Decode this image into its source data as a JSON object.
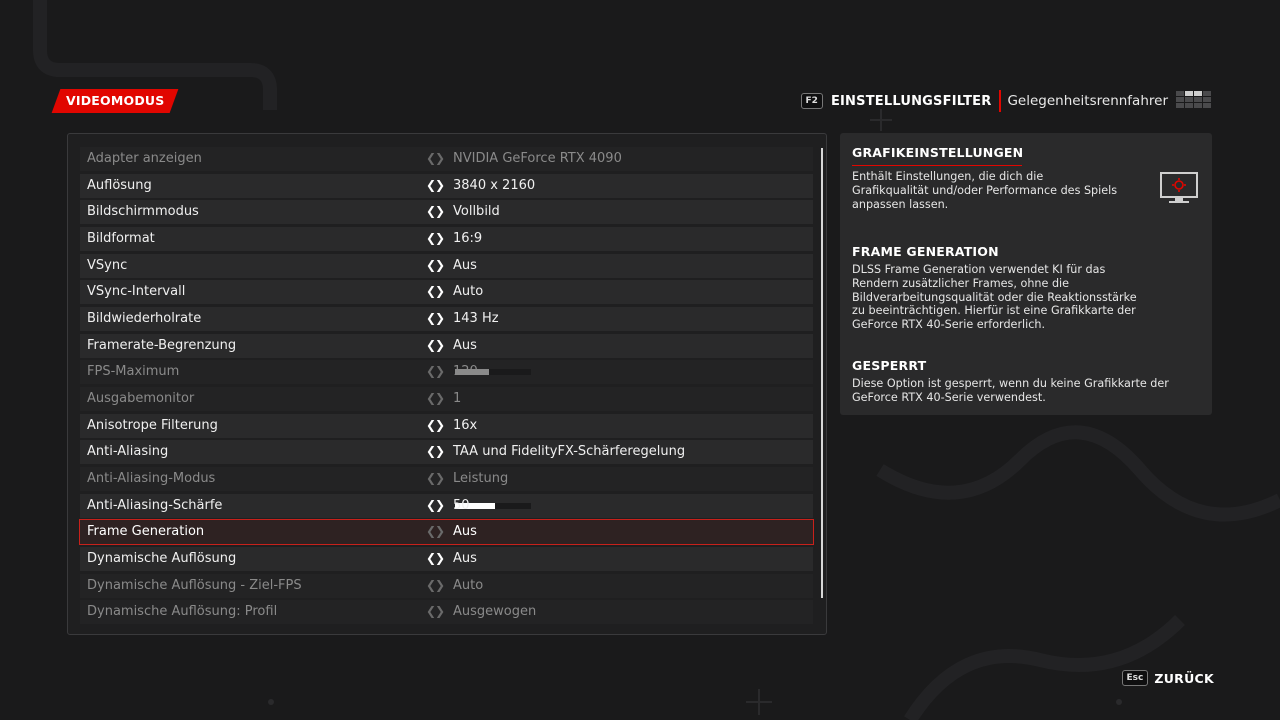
{
  "header": {
    "mode_label": "VIDEOMODUS",
    "filter_key": "F2",
    "filter_label": "EINSTELLUNGSFILTER",
    "filter_value": "Gelegenheitsrennfahrer",
    "filter_icon": "preset-grid-icon"
  },
  "settings": [
    {
      "label": "Adapter anzeigen",
      "value": "NVIDIA GeForce RTX 4090",
      "state": "disabled"
    },
    {
      "label": "Auflösung",
      "value": "3840 x 2160",
      "state": "enabled"
    },
    {
      "label": "Bildschirmmodus",
      "value": "Vollbild",
      "state": "enabled"
    },
    {
      "label": "Bildformat",
      "value": "16:9",
      "state": "enabled"
    },
    {
      "label": "VSync",
      "value": "Aus",
      "state": "enabled"
    },
    {
      "label": "VSync-Intervall",
      "value": "Auto",
      "state": "enabled"
    },
    {
      "label": "Bildwiederholrate",
      "value": "143 Hz",
      "state": "enabled"
    },
    {
      "label": "Framerate-Begrenzung",
      "value": "Aus",
      "state": "enabled"
    },
    {
      "label": "FPS-Maximum",
      "value": "120",
      "state": "disabled",
      "slider_fraction": 0.45
    },
    {
      "label": "Ausgabemonitor",
      "value": "1",
      "state": "disabled"
    },
    {
      "label": "Anisotrope Filterung",
      "value": "16x",
      "state": "enabled"
    },
    {
      "label": "Anti-Aliasing",
      "value": "TAA und FidelityFX-Schärferegelung",
      "state": "enabled"
    },
    {
      "label": "Anti-Aliasing-Modus",
      "value": "Leistung",
      "state": "disabled"
    },
    {
      "label": "Anti-Aliasing-Schärfe",
      "value": "50",
      "state": "enabled",
      "slider_fraction": 0.53
    },
    {
      "label": "Frame Generation",
      "value": "Aus",
      "state": "selected"
    },
    {
      "label": "Dynamische Auflösung",
      "value": "Aus",
      "state": "enabled"
    },
    {
      "label": "Dynamische Auflösung - Ziel-FPS",
      "value": "Auto",
      "state": "disabled"
    },
    {
      "label": "Dynamische Auflösung: Profil",
      "value": "Ausgewogen",
      "state": "disabled"
    }
  ],
  "info": {
    "section1_title": "GRAFIKEINSTELLUNGEN",
    "section1_text": "Enthält Einstellungen, die dich die Grafikqualität und/oder Performance des Spiels anpassen lassen.",
    "section2_title": "FRAME GENERATION",
    "section2_text": "DLSS Frame Generation verwendet KI für das Rendern zusätzlicher Frames, ohne die Bildverarbeitungsqualität oder die Reaktionsstärke zu beeinträchtigen. Hierfür ist eine Grafikkarte der GeForce RTX 40-Serie erforderlich.",
    "section3_title": "GESPERRT",
    "section3_text": "Diese Option ist gesperrt, wenn du keine Grafikkarte der GeForce RTX 40-Serie verwendest.",
    "icon": "monitor-gear-icon"
  },
  "footer": {
    "back_key": "Esc",
    "back_label": "ZURÜCK"
  },
  "colors": {
    "accent": "#e10600",
    "background": "#1a1a1b",
    "row": "#2a2a2b"
  }
}
